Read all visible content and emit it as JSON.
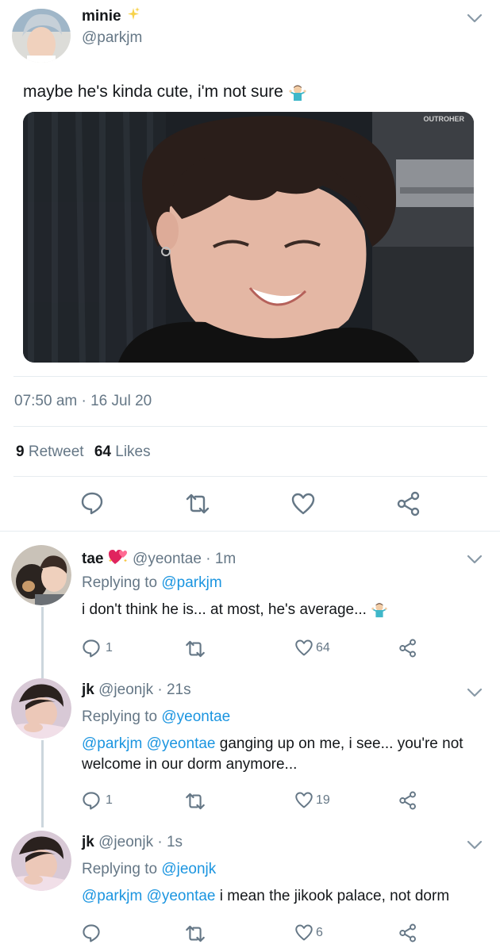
{
  "main_tweet": {
    "name": "minie",
    "handle": "@parkjm",
    "text": "maybe he's kinda cute, i'm not sure",
    "photo_watermark": "OUTROHER",
    "timestamp": "07:50 am · 16 Jul 20",
    "retweet_count": "9",
    "retweet_label": "Retweet",
    "likes_count": "64",
    "likes_label": "Likes"
  },
  "replies": [
    {
      "name": "tae",
      "handle": "@yeontae",
      "time": "· 1m",
      "replying_label": "Replying to",
      "replying_to": "@parkjm",
      "text": "i don't think he is... at most, he's average...",
      "reply_count": "1",
      "like_count": "64"
    },
    {
      "name": "jk",
      "handle": "@jeonjk",
      "time": "· 21s",
      "replying_label": "Replying to",
      "replying_to": "@yeontae",
      "mention1": "@parkjm",
      "mention2": "@yeontae",
      "text": "ganging up on me, i see... you're not welcome in our dorm anymore...",
      "reply_count": "1",
      "like_count": "19"
    },
    {
      "name": "jk",
      "handle": "@jeonjk",
      "time": "· 1s",
      "replying_label": "Replying to",
      "replying_to": "@jeonjk",
      "mention1": "@parkjm",
      "mention2": "@yeontae",
      "text": "i mean the jikook palace, not dorm",
      "like_count": "6"
    }
  ],
  "colors": {
    "link": "#1b95e0",
    "secondary_text": "#657786",
    "divider": "#e6ecf0"
  },
  "icons": [
    "chevron-down-icon",
    "sparkles-icon",
    "shrug-emoji-icon",
    "reply-icon",
    "retweet-icon",
    "heart-icon",
    "share-icon",
    "hearts-emoji-icon"
  ]
}
